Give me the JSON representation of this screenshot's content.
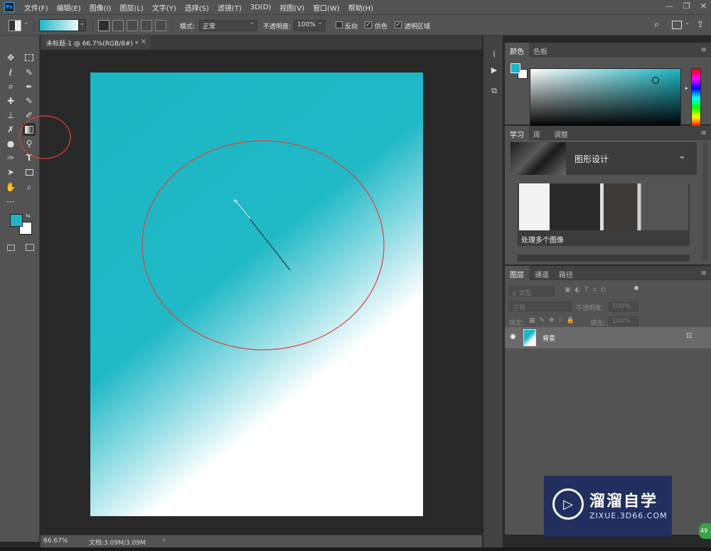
{
  "app": {
    "logo_text": "Ps"
  },
  "menu": {
    "items": [
      "文件(F)",
      "编辑(E)",
      "图像(I)",
      "图层(L)",
      "文字(Y)",
      "选择(S)",
      "滤镜(T)",
      "3D(D)",
      "视图(V)",
      "窗口(W)",
      "帮助(H)"
    ]
  },
  "window_controls": {
    "minimize": "—",
    "restore": "❐",
    "close": "✕"
  },
  "options_bar": {
    "mode_label": "模式:",
    "mode_value": "正常",
    "opacity_label": "不透明度:",
    "opacity_value": "100%",
    "reverse_label": "反向",
    "reverse_checked": false,
    "dither_label": "仿色",
    "dither_checked": true,
    "transparency_label": "透明区域",
    "transparency_checked": true,
    "gradient_colors": [
      "#1fb8c6",
      "#ffffff"
    ]
  },
  "document": {
    "tab_title": "未标题-1 @ 66.7%(RGB/8#) *",
    "close_symbol": "×"
  },
  "status": {
    "zoom": "66.67%",
    "doc_info": "文档:3.09M/3.09M",
    "arrow": "›"
  },
  "colors": {
    "foreground": "#1fb5c4",
    "background": "#ffffff",
    "annotation": "#e0403a"
  },
  "color_panel": {
    "tabs": [
      "颜色",
      "色板"
    ]
  },
  "learn_panel": {
    "tabs": [
      "学习",
      "库",
      "调整"
    ],
    "header_title": "图形设计",
    "card_title": "处理多个图像"
  },
  "layers_panel": {
    "tabs": [
      "图层",
      "通道",
      "路径"
    ],
    "filter_placeholder": "ρ 类型",
    "blend_mode": "正常",
    "opacity_label": "不透明度:",
    "opacity_value": "100%",
    "lock_label": "锁定:",
    "fill_label": "填充:",
    "fill_value": "100%",
    "layer_name": "背景"
  },
  "watermark": {
    "title": "溜溜自学",
    "url": "ZIXUE.3D66.COM",
    "badge": "49"
  }
}
